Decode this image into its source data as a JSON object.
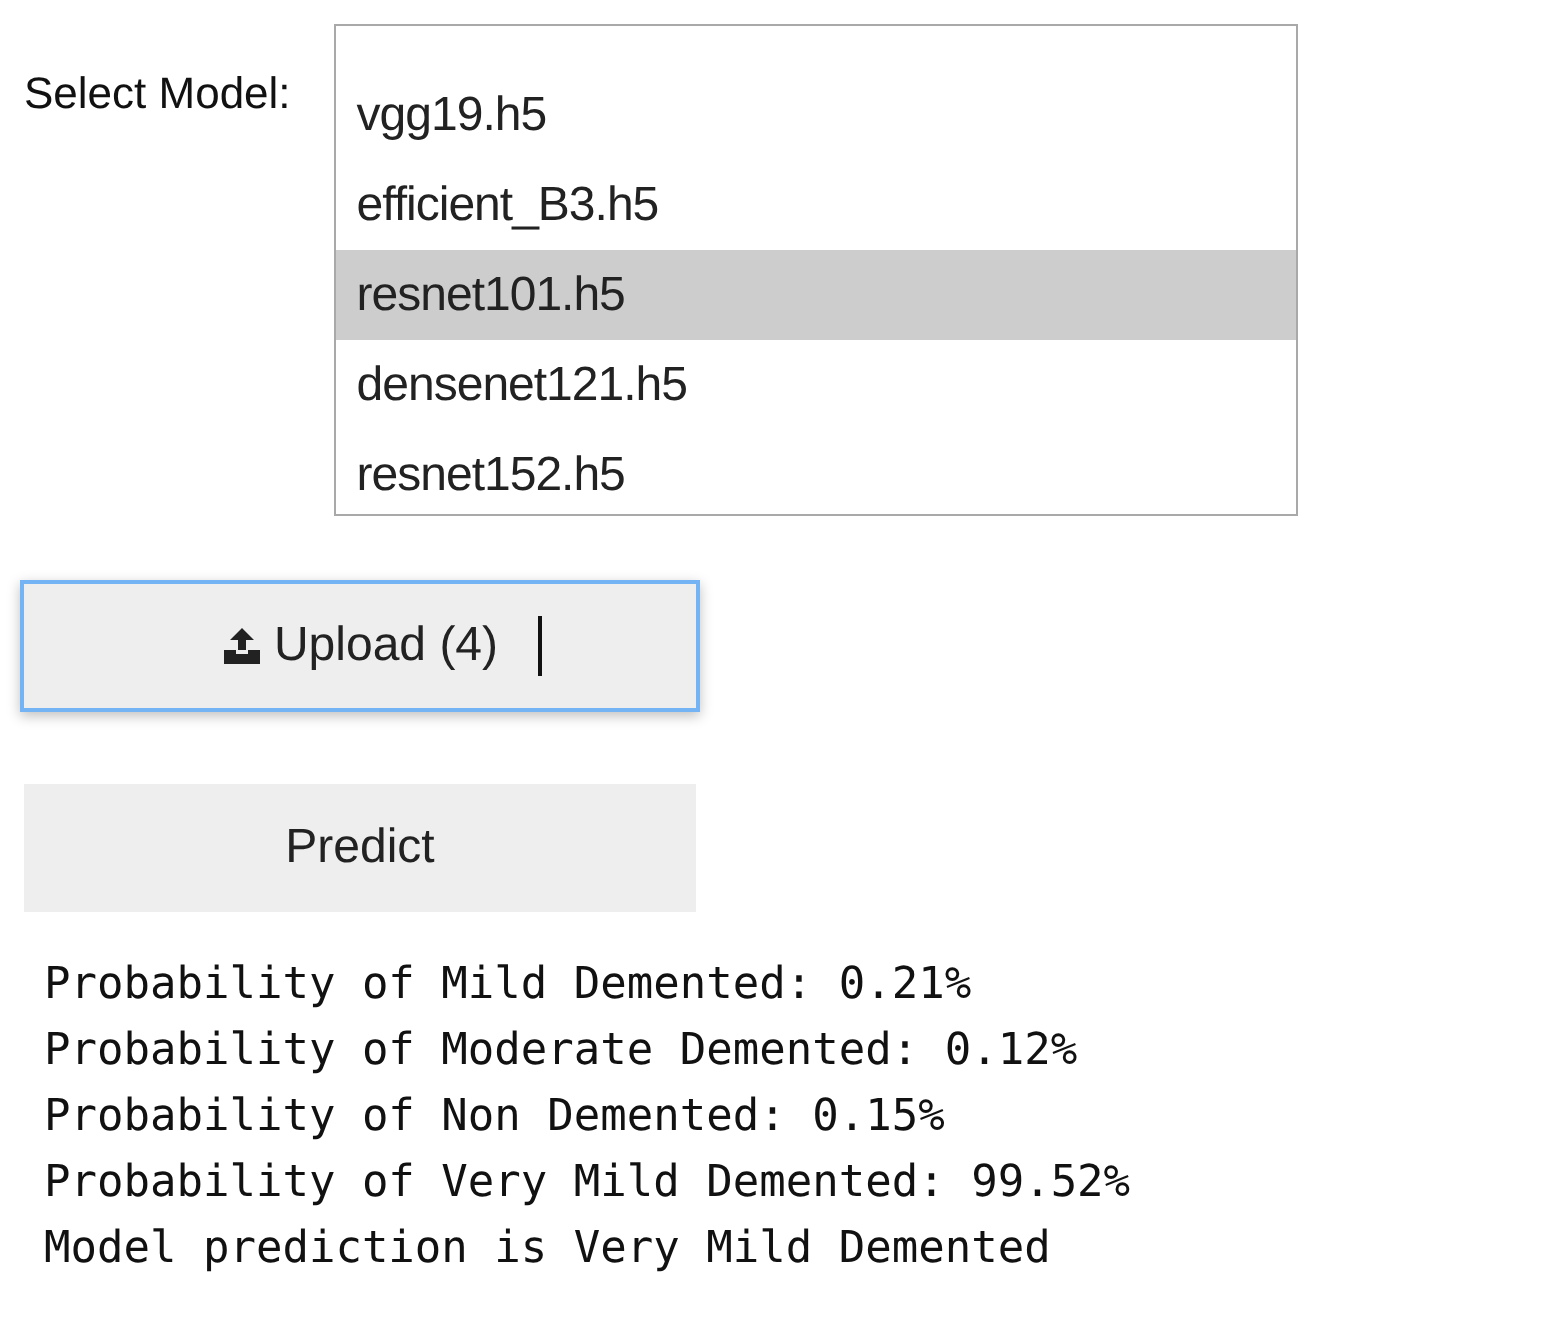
{
  "model_select": {
    "label": "Select Model:",
    "options": [
      {
        "label": "vgg19.h5",
        "selected": false
      },
      {
        "label": "efficient_B3.h5",
        "selected": false
      },
      {
        "label": "resnet101.h5",
        "selected": true
      },
      {
        "label": "densenet121.h5",
        "selected": false
      },
      {
        "label": "resnet152.h5",
        "selected": false
      }
    ]
  },
  "upload_button": {
    "label": "Upload (4)",
    "focused": true
  },
  "predict_button": {
    "label": "Predict"
  },
  "output": [
    "Probability of Mild Demented: 0.21%",
    "Probability of Moderate Demented: 0.12%",
    "Probability of Non Demented: 0.15%",
    "Probability of Very Mild Demented: 99.52%",
    "Model prediction is Very Mild Demented"
  ]
}
